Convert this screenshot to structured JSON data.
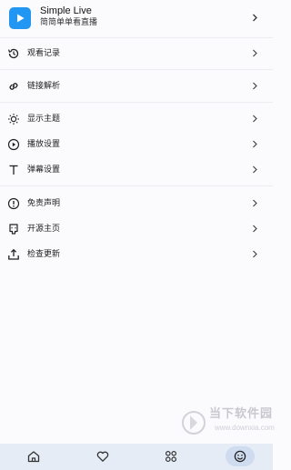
{
  "header": {
    "app_name": "Simple Live",
    "subtitle": "简简单单看直播",
    "logo_icon": "play-icon",
    "accent": "#2196f3"
  },
  "menu": {
    "items": [
      {
        "label": "观看记录",
        "icon": "history-icon"
      },
      {
        "label": "链接解析",
        "icon": "link-icon"
      },
      {
        "label": "显示主题",
        "icon": "sun-icon"
      },
      {
        "label": "播放设置",
        "icon": "play-circle-icon"
      },
      {
        "label": "弹幕设置",
        "icon": "text-icon"
      },
      {
        "label": "免责声明",
        "icon": "alert-icon"
      },
      {
        "label": "开源主页",
        "icon": "github-icon"
      },
      {
        "label": "检查更新",
        "icon": "upload-icon"
      }
    ]
  },
  "tabbar": {
    "tabs": [
      {
        "icon": "home-icon",
        "active": false
      },
      {
        "icon": "heart-icon",
        "active": false
      },
      {
        "icon": "categories-icon",
        "active": false
      },
      {
        "icon": "smile-icon",
        "active": true
      }
    ],
    "background": "#e6ecf5"
  },
  "watermark": {
    "title": "当下软件园",
    "url": "www.downxia.com"
  }
}
